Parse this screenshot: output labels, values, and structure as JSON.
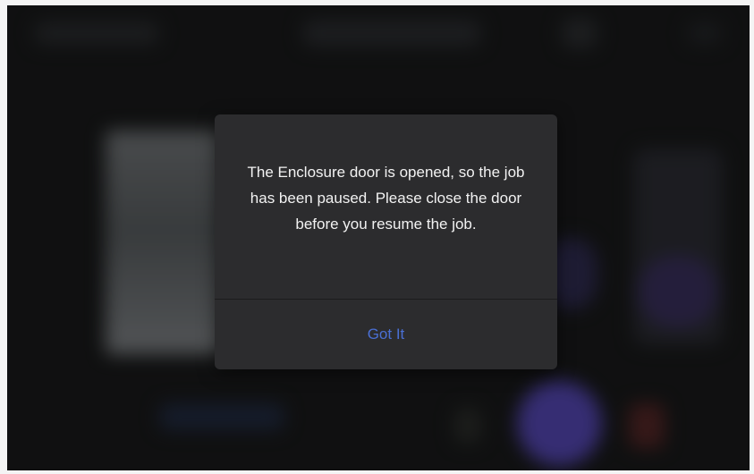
{
  "dialog": {
    "message": "The Enclosure door is opened, so the job has been paused. Please close the door before you resume the job.",
    "button_label": "Got It",
    "button_color": "#4a6fd4"
  }
}
